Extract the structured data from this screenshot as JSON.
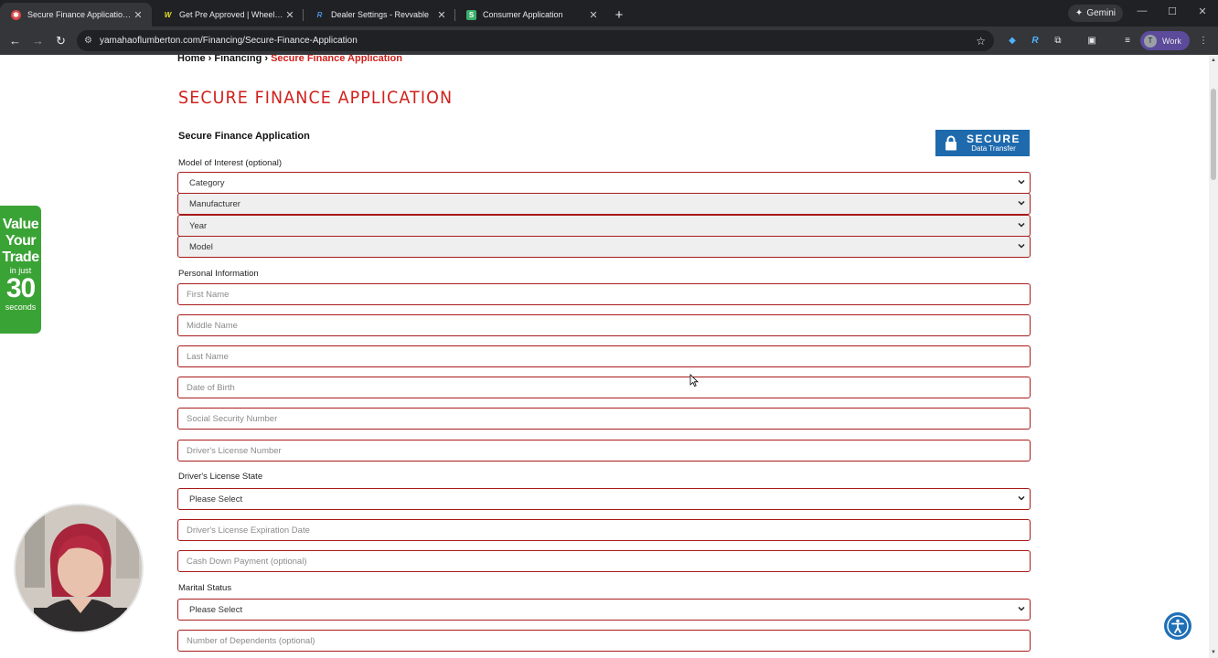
{
  "browser": {
    "tabs": [
      {
        "title": "Secure Finance Application | Ya",
        "favicon_color": "#d84545",
        "active": true
      },
      {
        "title": "Get Pre Approved | Wheels In M",
        "favicon_color": "#e8e02a",
        "active": false
      },
      {
        "title": "Dealer Settings - Revvable",
        "favicon_color": "#4a90d9",
        "active": false
      },
      {
        "title": "Consumer Application",
        "favicon_color": "#3ab06b",
        "active": false
      }
    ],
    "new_tab": "+",
    "gemini_label": "Gemini",
    "url": "yamahaoflumberton.com/Financing/Secure-Finance-Application",
    "profile_initial": "T",
    "profile_label": "Work"
  },
  "breadcrumb": {
    "home": "Home",
    "sep1": " › ",
    "financing": "Financing",
    "sep2": " › ",
    "current": "Secure Finance Application"
  },
  "page_title": "SECURE FINANCE APPLICATION",
  "form_title": "Secure Finance Application",
  "secure_badge": {
    "line1": "SECURE",
    "line2": "Data Transfer"
  },
  "model_section": {
    "label": "Model of Interest (optional)",
    "category": "Category",
    "manufacturer": "Manufacturer",
    "year": "Year",
    "model": "Model"
  },
  "personal_section": {
    "label": "Personal Information",
    "first_name": "First Name",
    "middle_name": "Middle Name",
    "last_name": "Last Name",
    "dob": "Date of Birth",
    "ssn": "Social Security Number",
    "dl_number": "Driver's License Number"
  },
  "dl_state": {
    "label": "Driver's License State",
    "value": "Please Select"
  },
  "dl_expiration": "Driver's License Expiration Date",
  "cash_down": "Cash Down Payment (optional)",
  "marital": {
    "label": "Marital Status",
    "value": "Please Select"
  },
  "dependents": "Number of Dependents (optional)",
  "trade_widget": {
    "line1": "Value",
    "line2": "Your",
    "line3": "Trade",
    "line4": "in just",
    "line5": "30",
    "line6": "seconds"
  },
  "colors": {
    "accent_red": "#d0211c",
    "border_red": "#a81a1a",
    "secure_blue": "#1e6aad",
    "trade_green": "#3aa335"
  }
}
